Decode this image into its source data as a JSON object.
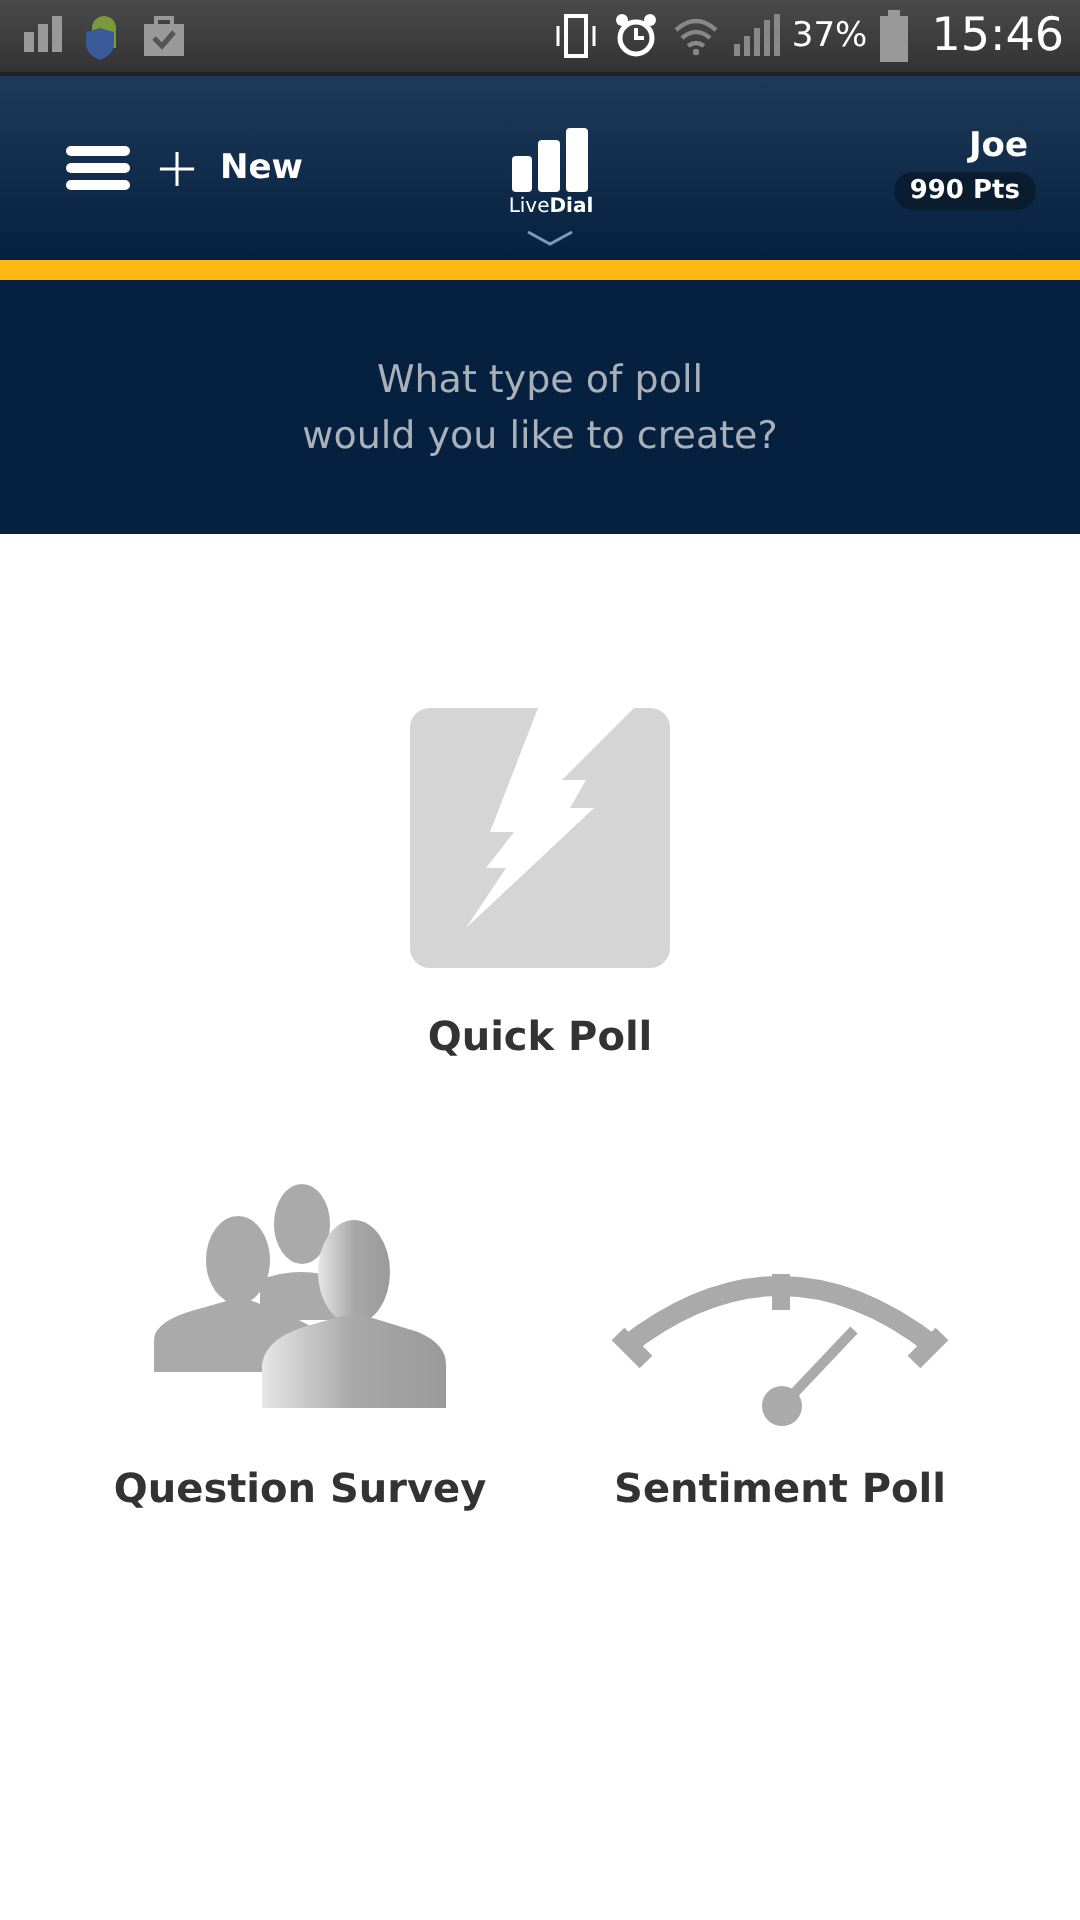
{
  "status_bar": {
    "battery": "37%",
    "time": "15:46"
  },
  "header": {
    "new_label": "New",
    "logo_text": "Live**Dial**",
    "user_name": "Joe",
    "points": "990 Pts"
  },
  "prompt": {
    "lines": [
      "What type of poll",
      "would you like to create?"
    ]
  },
  "poll_types": [
    {
      "kind": "quick",
      "label": "Quick Poll"
    },
    {
      "kind": "survey",
      "label": "Question Survey"
    },
    {
      "kind": "sentiment",
      "label": "Sentiment Poll"
    }
  ]
}
